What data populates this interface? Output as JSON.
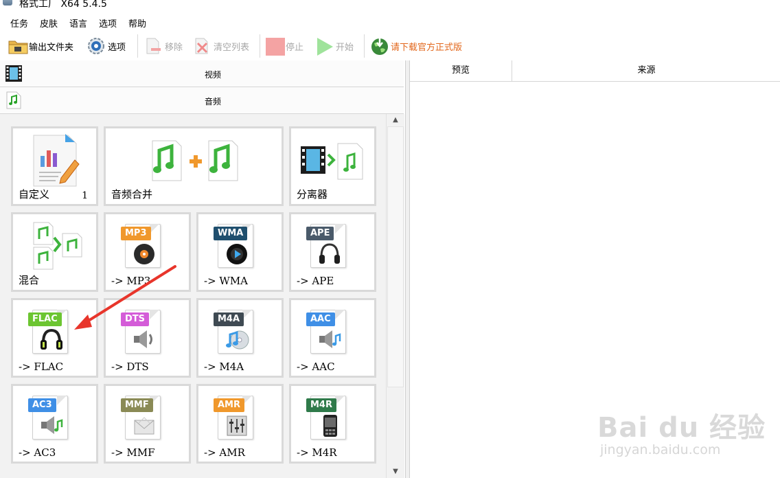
{
  "window": {
    "title": "格式工厂  X64 5.4.5"
  },
  "menu": [
    "任务",
    "皮肤",
    "语言",
    "选项",
    "帮助"
  ],
  "toolbar": {
    "output_folder": "输出文件夹",
    "options": "选项",
    "remove": "移除",
    "clear_list": "清空列表",
    "stop": "停止",
    "start": "开始",
    "download": "请下载官方正式版"
  },
  "categories": {
    "video": "视频",
    "audio": "音频"
  },
  "tiles": [
    {
      "label": "自定义",
      "count": "1",
      "icon": "custom-icon"
    },
    {
      "label": "音频合并",
      "icon": "audio-merge-icon"
    },
    {
      "label": "分离器",
      "icon": "splitter-icon"
    },
    {
      "label": "混合",
      "icon": "mix-icon"
    },
    {
      "label": "-> MP3",
      "badge": "MP3",
      "badge_color": "#f0982c",
      "icon": "mp3-file-icon"
    },
    {
      "label": "-> WMA",
      "badge": "WMA",
      "badge_color": "#1f4f6e",
      "icon": "wma-file-icon"
    },
    {
      "label": "-> APE",
      "badge": "APE",
      "badge_color": "#4a5a6a",
      "icon": "ape-file-icon"
    },
    {
      "label": "-> FLAC",
      "badge": "FLAC",
      "badge_color": "#6cc531",
      "icon": "flac-file-icon"
    },
    {
      "label": "-> DTS",
      "badge": "DTS",
      "badge_color": "#d45cd8",
      "icon": "dts-file-icon"
    },
    {
      "label": "-> M4A",
      "badge": "M4A",
      "badge_color": "#3f4a53",
      "icon": "m4a-file-icon"
    },
    {
      "label": "-> AAC",
      "badge": "AAC",
      "badge_color": "#3f8fe6",
      "icon": "aac-file-icon"
    },
    {
      "label": "-> AC3",
      "badge": "AC3",
      "badge_color": "#3f8fe6",
      "icon": "ac3-file-icon"
    },
    {
      "label": "-> MMF",
      "badge": "MMF",
      "badge_color": "#8a8a55",
      "icon": "mmf-file-icon"
    },
    {
      "label": "-> AMR",
      "badge": "AMR",
      "badge_color": "#f0982c",
      "icon": "amr-file-icon"
    },
    {
      "label": "-> M4R",
      "badge": "M4R",
      "badge_color": "#2f7a4a",
      "icon": "m4r-file-icon"
    }
  ],
  "list": {
    "col_preview": "预览",
    "col_source": "来源"
  },
  "watermark": {
    "brand": "Bai du 经验",
    "url": "jingyan.baidu.com"
  },
  "colors": {
    "accent_orange": "#e2661a",
    "arrow_red": "#e8352b"
  }
}
